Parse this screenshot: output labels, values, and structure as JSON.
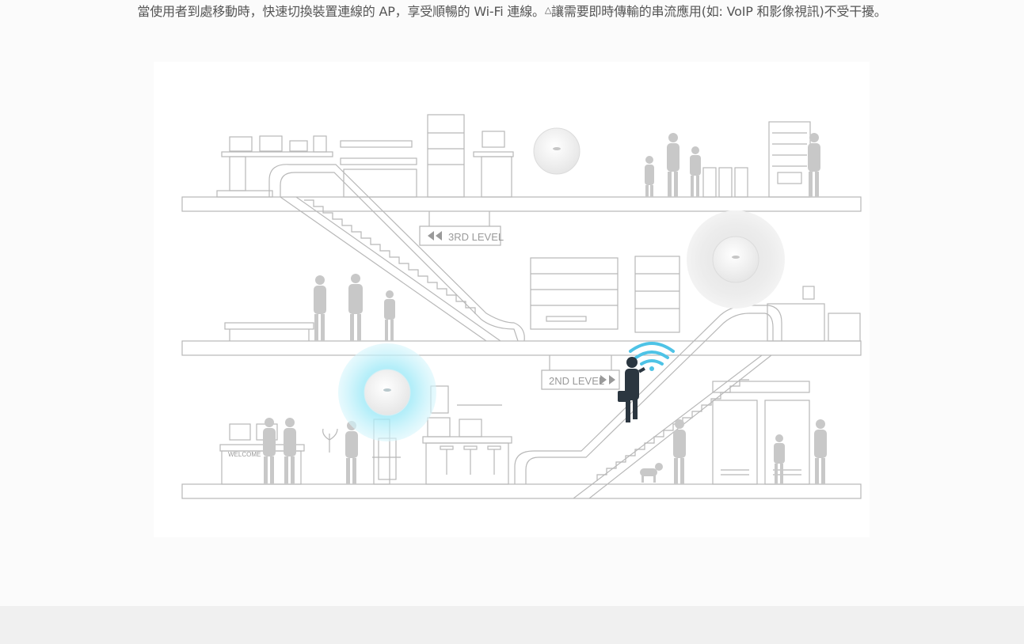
{
  "intro": {
    "line_main": "當使用者到處移動時，快速切換裝置連線的 AP，享受順暢的 Wi-Fi 連線。",
    "footnote_mark": "△",
    "line_rest": "讓需要即時傳輸的串流應用(如: VoIP 和影像視訊)不受干擾。"
  },
  "illustration": {
    "level3_sign": "3RD LEVEL",
    "level2_sign": "2ND LEVEL",
    "welcome_sign": "WELCOME",
    "active_ap_color": "#5fd0ea",
    "wifi_signal_color": "#4ec3e6",
    "user_figure_color": "#2b3640",
    "line_color": "#b5b5b5"
  }
}
